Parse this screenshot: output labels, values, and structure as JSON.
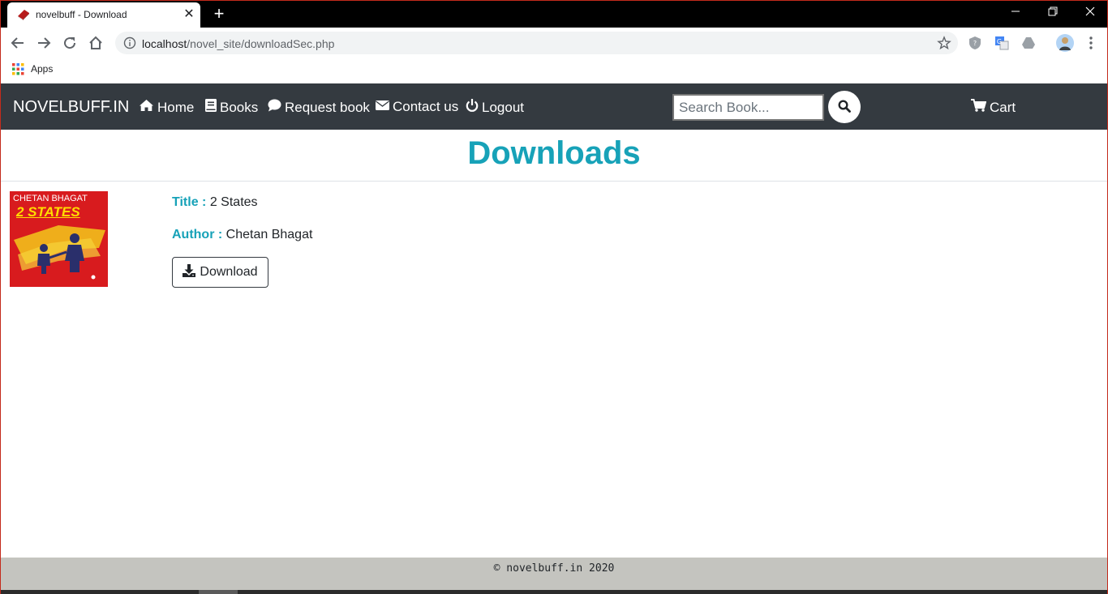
{
  "browser": {
    "tab_title": "novelbuff - Download",
    "url_host": "localhost",
    "url_path": "/novel_site/downloadSec.php",
    "bookmark_apps": "Apps"
  },
  "navbar": {
    "brand": "NOVELBUFF.IN",
    "links": [
      {
        "label": "Home",
        "icon": "home-icon"
      },
      {
        "label": "Books",
        "icon": "book-icon"
      },
      {
        "label": "Request book",
        "icon": "comment-icon"
      },
      {
        "label": "Contact us",
        "icon": "envelope-icon"
      },
      {
        "label": "Logout",
        "icon": "power-icon"
      }
    ],
    "search_placeholder": "Search Book...",
    "cart_label": "Cart"
  },
  "main": {
    "heading": "Downloads",
    "book": {
      "title_label": "Title :",
      "title": "2 States",
      "author_label": "Author :",
      "author": "Chetan Bhagat",
      "cover_author": "CHETAN BHAGAT",
      "cover_title": "2 STATES",
      "download_label": "Download"
    }
  },
  "footer": {
    "text": "© novelbuff.in 2020"
  },
  "colors": {
    "accent": "#17a2b8",
    "navbar_bg": "#343a40",
    "footer_bg": "#c4c4bf"
  }
}
